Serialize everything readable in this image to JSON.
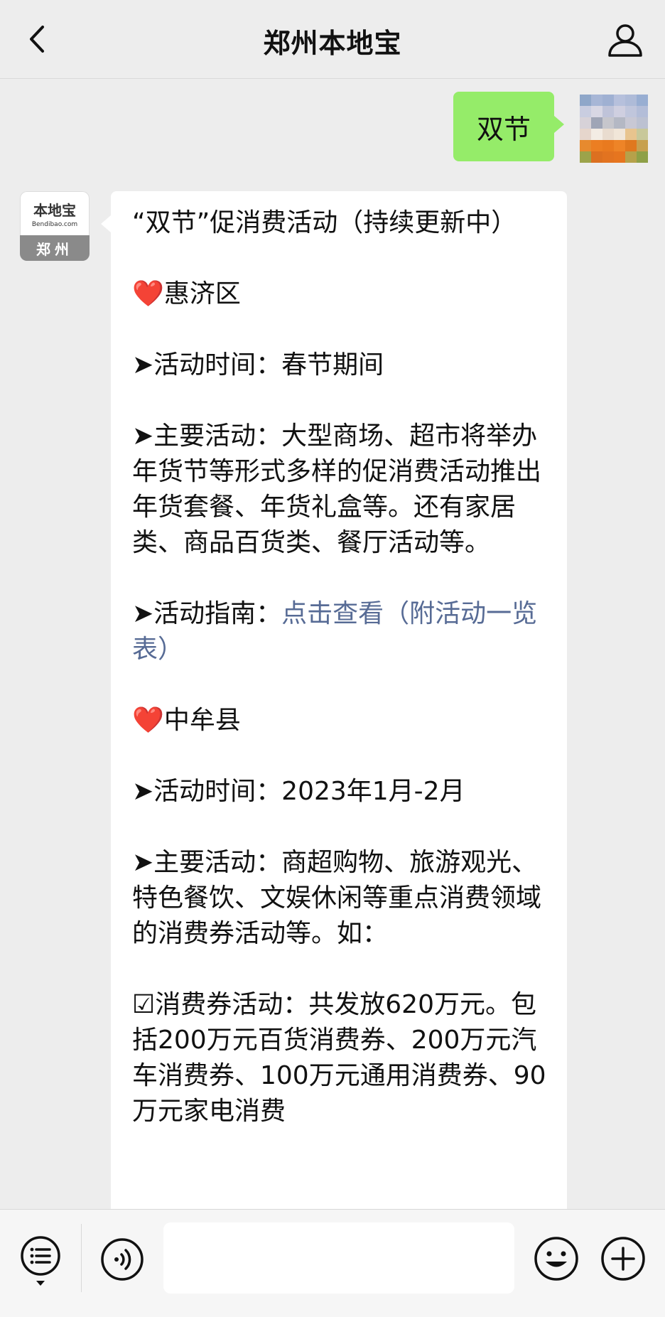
{
  "header": {
    "title": "郑州本地宝",
    "back_icon": "chevron-left-icon",
    "profile_icon": "person-icon"
  },
  "me_message": {
    "text": "双节",
    "bubble_color": "#95ec69"
  },
  "bot": {
    "avatar": {
      "brand": "本地宝",
      "domain": "Bendibao.com",
      "city": "郑州"
    },
    "message": {
      "title": "“双节”促消费活动（持续更新中）",
      "district1": {
        "heart": "❤️",
        "name": "惠济区",
        "time": "➤活动时间：春节期间",
        "main": "➤主要活动：大型商场、超市将举办年货节等形式多样的促消费活动推出年货套餐、年货礼盒等。还有家居类、商品百货类、餐厅活动等。",
        "guide_prefix": "➤活动指南：",
        "guide_link": "点击查看（附活动一览表）"
      },
      "district2": {
        "heart": "❤️",
        "name": "中牟县",
        "time": "➤活动时间：2023年1月-2月",
        "main": "➤主要活动：商超购物、旅游观光、特色餐饮、文娱休闲等重点消费领域的消费券活动等。如：",
        "coupon": "☑消费券活动：共发放620万元。包括200万元百货消费券、200万元汽车消费券、100万元通用消费券、90万元家电消费"
      }
    }
  },
  "input_bar": {
    "menu_icon": "list-menu-icon",
    "voice_icon": "voice-icon",
    "emoji_icon": "emoji-icon",
    "plus_icon": "plus-icon",
    "placeholder": ""
  },
  "colors": {
    "background": "#ededed",
    "link": "#576b95",
    "heart": "#e0161f"
  }
}
